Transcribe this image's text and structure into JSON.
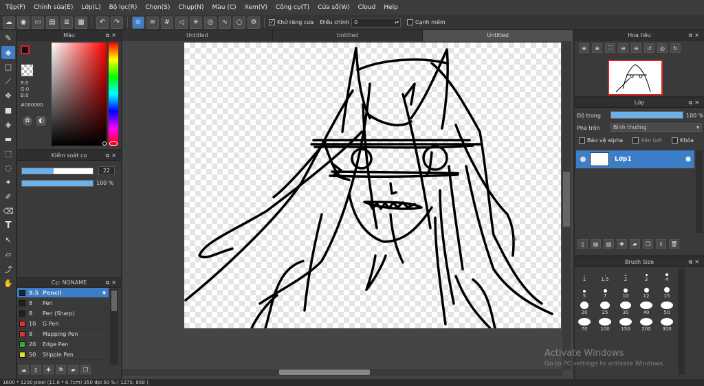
{
  "menu": [
    "Tệp(F)",
    "Chỉnh sửa(E)",
    "Lớp(L)",
    "Bộ lọc(R)",
    "Chọn(S)",
    "Chụp(N)",
    "Màu (C)",
    "Xem(V)",
    "Công cụ(T)",
    "Cửa số(W)",
    "Cloud",
    "Help"
  ],
  "toolbar": {
    "antialias_label": "Khử răng cưa",
    "adjust_label": "Điều chỉnh",
    "adjust_value": "0",
    "soft_edge_label": "Cạnh mềm"
  },
  "color_panel": {
    "title": "Màu",
    "r": "R:0",
    "g": "G:0",
    "b": "B:0",
    "hex": "#000000"
  },
  "brush_control": {
    "title": "Kiểm soát cọ",
    "size_value": "22",
    "opacity_value": "100 %",
    "size_fraction": 0.45,
    "opacity_fraction": 1.0
  },
  "brush_panel": {
    "title": "Cọ: NONAME",
    "items": [
      {
        "size": "9.5",
        "name": "Pencil",
        "color": "#222222"
      },
      {
        "size": "8",
        "name": "Pen",
        "color": "#222222"
      },
      {
        "size": "8",
        "name": "Pen (Sharp)",
        "color": "#222222"
      },
      {
        "size": "10",
        "name": "G Pen",
        "color": "#e03030"
      },
      {
        "size": "8",
        "name": "Mapping Pen",
        "color": "#e03030"
      },
      {
        "size": "20",
        "name": "Edge Pen",
        "color": "#30b030"
      },
      {
        "size": "50",
        "name": "Stipple Pen",
        "color": "#e0e030"
      }
    ]
  },
  "tabs": [
    "Untitled",
    "Untitled",
    "Untitled"
  ],
  "navigator": {
    "title": "Hoa tiêu"
  },
  "layer_panel": {
    "title": "Lớp",
    "opacity_label": "Độ trong",
    "opacity_value": "100 %",
    "blend_label": "Pha trộn",
    "blend_value": "Bình thường",
    "protect_alpha": "Bảo vệ alpha",
    "clipping": "Xén bớt",
    "lock": "Khóa",
    "layer_name": "Lớp1"
  },
  "brush_size_panel": {
    "title": "Brush Size",
    "sizes": [
      "1",
      "1.5",
      "2",
      "3",
      "4",
      "5",
      "7",
      "10",
      "12",
      "15",
      "20",
      "25",
      "30",
      "40",
      "50",
      "70",
      "100",
      "150",
      "200",
      "300"
    ]
  },
  "status": "1600 * 1200 pixel   (11.6 * 8.7cm)   350 dpi   50 %   ( 1275, 858 )",
  "watermark": {
    "line1": "Activate Windows",
    "line2": "Go to PC settings to activate Windows."
  }
}
